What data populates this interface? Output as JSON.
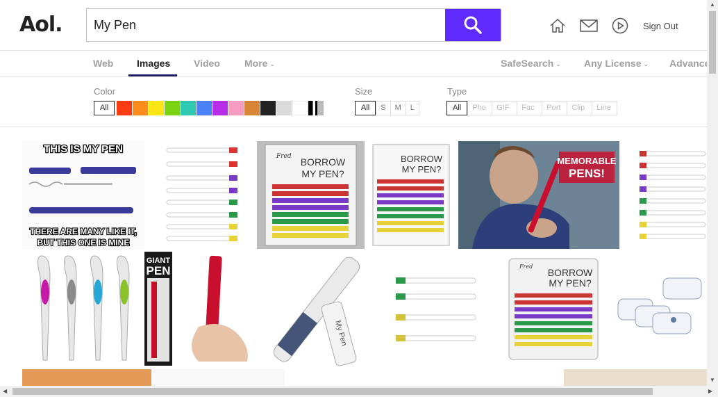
{
  "header": {
    "logo": "Aol.",
    "search_value": "My Pen",
    "search_icon": "search-icon",
    "home_icon": "home-icon",
    "mail_icon": "mail-icon",
    "video_icon": "play-icon",
    "sign_out": "Sign Out",
    "accent": "#5f2bff"
  },
  "nav": {
    "tabs": [
      "Web",
      "Images",
      "Video",
      "More"
    ],
    "active_tab": "Images",
    "safesearch": "SafeSearch",
    "license": "Any License",
    "advanced": "Advance"
  },
  "filters": {
    "color_label": "Color",
    "size_label": "Size",
    "type_label": "Type",
    "all": "All",
    "colors": [
      "#fc3b12",
      "#fc8c1c",
      "#fbe514",
      "#7ad412",
      "#2ec9b0",
      "#4b82f8",
      "#b72de8",
      "#f99bc0",
      "#d98536",
      "#232323",
      "#dadada",
      "#ffffff"
    ],
    "sizes": [
      "S",
      "M",
      "L"
    ],
    "types": [
      "Pho",
      "GIF",
      "Fac",
      "Port",
      "Clip",
      "Line"
    ]
  },
  "images": {
    "meme_top": "THIS IS MY PEN",
    "meme_bottom1": "THERE ARE MANY LIKE IT,",
    "meme_bottom2": "BUT THIS ONE IS MINE",
    "borrow": "BORROW",
    "my_pen": "MY PEN?",
    "memorable": "MEMORABLE",
    "pens": "PENS!",
    "giant": "GIANT",
    "pen": "PEN",
    "engraving": "My Pen",
    "fred": "Fred"
  }
}
